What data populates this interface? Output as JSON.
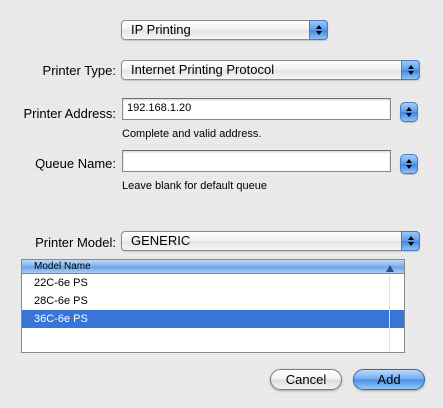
{
  "connection_popup": {
    "value": "IP Printing"
  },
  "printer_type": {
    "label": "Printer Type:",
    "value": "Internet Printing Protocol"
  },
  "printer_address": {
    "label": "Printer Address:",
    "value": "192.168.1.20",
    "helper": "Complete and valid address."
  },
  "queue_name": {
    "label": "Queue Name:",
    "value": "",
    "helper": "Leave blank for default queue"
  },
  "printer_model": {
    "label": "Printer Model:",
    "value": "GENERIC"
  },
  "model_table": {
    "column_header": "Model Name",
    "rows": [
      "22C-6e PS",
      "28C-6e PS",
      "36C-6e PS"
    ],
    "selected_index": 2
  },
  "buttons": {
    "cancel": "Cancel",
    "add": "Add"
  },
  "colors": {
    "selection": "#3875d7",
    "aqua": "#5b9ee8"
  }
}
